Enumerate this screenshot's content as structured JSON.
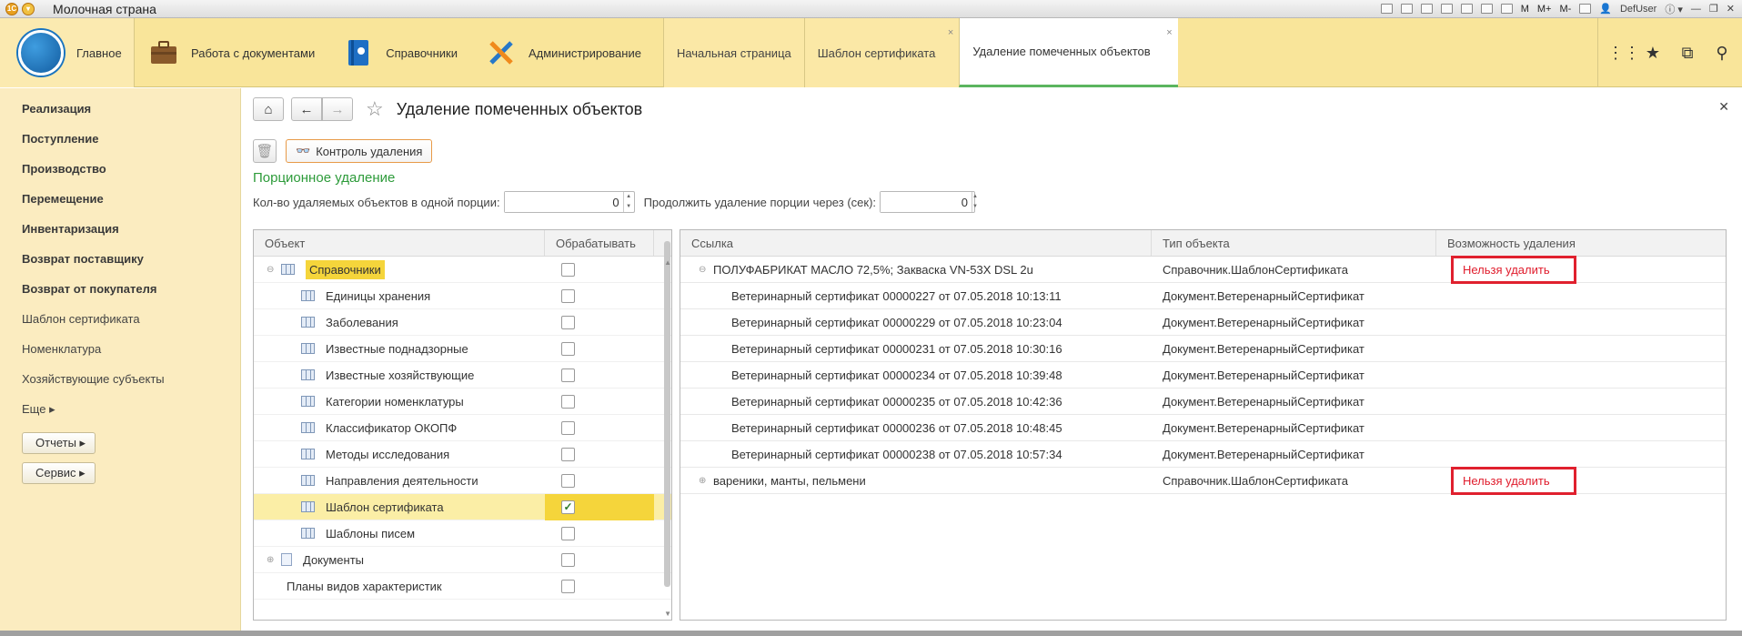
{
  "window": {
    "title": "Молочная страна",
    "user": "DefUser",
    "m_labels": [
      "M",
      "M+",
      "M-"
    ]
  },
  "nav": {
    "home": "Главное",
    "sections": [
      "Работа с документами",
      "Справочники",
      "Администрирование"
    ],
    "tabs": [
      "Начальная страница",
      "Шаблон сертификата",
      "Удаление помеченных объектов"
    ],
    "close_glyph": "×"
  },
  "sidebar": {
    "items": [
      {
        "label": "Реализация",
        "bold": true
      },
      {
        "label": "Поступление",
        "bold": true
      },
      {
        "label": "Производство",
        "bold": true
      },
      {
        "label": "Перемещение",
        "bold": true
      },
      {
        "label": "Инвентаризация",
        "bold": true
      },
      {
        "label": "Возврат поставщику",
        "bold": true
      },
      {
        "label": "Возврат от покупателя",
        "bold": true
      },
      {
        "label": "Шаблон сертификата",
        "bold": false
      },
      {
        "label": "Номенклатура",
        "bold": false
      },
      {
        "label": "Хозяйствующие субъекты",
        "bold": false
      },
      {
        "label": "Еще ▸",
        "bold": false
      }
    ],
    "buttons": [
      "Отчеты ▸",
      "Сервис ▸"
    ]
  },
  "page": {
    "title": "Удаление помеченных объектов",
    "control_button": "Контроль удаления",
    "section_title": "Порционное удаление",
    "portion_label": "Кол-во удаляемых объектов в одной порции:",
    "portion_value": "0",
    "continue_label": "Продолжить удаление порции через (сек):",
    "continue_value": "0"
  },
  "left_table": {
    "headers": [
      "Объект",
      "Обрабатывать"
    ],
    "rows": [
      {
        "label": "Справочники",
        "level": 0,
        "expander": "⊖",
        "icon": "grid",
        "checked": false,
        "highlight": true,
        "selected": false
      },
      {
        "label": "Единицы хранения",
        "level": 1,
        "expander": "",
        "icon": "grid",
        "checked": false,
        "highlight": false,
        "selected": false
      },
      {
        "label": "Заболевания",
        "level": 1,
        "expander": "",
        "icon": "grid",
        "checked": false,
        "highlight": false,
        "selected": false
      },
      {
        "label": "Известные поднадзорные",
        "level": 1,
        "expander": "",
        "icon": "grid",
        "checked": false,
        "highlight": false,
        "selected": false
      },
      {
        "label": "Известные хозяйствующие",
        "level": 1,
        "expander": "",
        "icon": "grid",
        "checked": false,
        "highlight": false,
        "selected": false
      },
      {
        "label": "Категории номенклатуры",
        "level": 1,
        "expander": "",
        "icon": "grid",
        "checked": false,
        "highlight": false,
        "selected": false
      },
      {
        "label": "Классификатор ОКОПФ",
        "level": 1,
        "expander": "",
        "icon": "grid",
        "checked": false,
        "highlight": false,
        "selected": false
      },
      {
        "label": "Методы исследования",
        "level": 1,
        "expander": "",
        "icon": "grid",
        "checked": false,
        "highlight": false,
        "selected": false
      },
      {
        "label": "Направления деятельности",
        "level": 1,
        "expander": "",
        "icon": "grid",
        "checked": false,
        "highlight": false,
        "selected": false
      },
      {
        "label": "Шаблон сертификата",
        "level": 1,
        "expander": "",
        "icon": "grid",
        "checked": true,
        "highlight": false,
        "selected": true
      },
      {
        "label": "Шаблоны писем",
        "level": 1,
        "expander": "",
        "icon": "grid",
        "checked": false,
        "highlight": false,
        "selected": false
      },
      {
        "label": "Документы",
        "level": 0,
        "expander": "⊕",
        "icon": "doc",
        "checked": false,
        "highlight": false,
        "selected": false
      },
      {
        "label": "Планы видов характеристик",
        "level": 0,
        "expander": "",
        "icon": "",
        "checked": false,
        "highlight": false,
        "selected": false
      }
    ]
  },
  "right_table": {
    "headers": [
      "Ссылка",
      "Тип объекта",
      "Возможность удаления"
    ],
    "rows": [
      {
        "link": "ПОЛУФАБРИКАТ МАСЛО 72,5%; Закваска VN-53X DSL 2u",
        "type": "Справочник.ШаблонСертификата",
        "status": "Нельзя удалить",
        "expander": "⊖",
        "child": false
      },
      {
        "link": "Ветеринарный сертификат 00000227 от 07.05.2018 10:13:11",
        "type": "Документ.ВетеренарныйСертификат",
        "status": "",
        "expander": "",
        "child": true
      },
      {
        "link": "Ветеринарный сертификат 00000229 от 07.05.2018 10:23:04",
        "type": "Документ.ВетеренарныйСертификат",
        "status": "",
        "expander": "",
        "child": true
      },
      {
        "link": "Ветеринарный сертификат 00000231 от 07.05.2018 10:30:16",
        "type": "Документ.ВетеренарныйСертификат",
        "status": "",
        "expander": "",
        "child": true
      },
      {
        "link": "Ветеринарный сертификат 00000234 от 07.05.2018 10:39:48",
        "type": "Документ.ВетеренарныйСертификат",
        "status": "",
        "expander": "",
        "child": true
      },
      {
        "link": "Ветеринарный сертификат 00000235 от 07.05.2018 10:42:36",
        "type": "Документ.ВетеренарныйСертификат",
        "status": "",
        "expander": "",
        "child": true
      },
      {
        "link": "Ветеринарный сертификат 00000236 от 07.05.2018 10:48:45",
        "type": "Документ.ВетеренарныйСертификат",
        "status": "",
        "expander": "",
        "child": true
      },
      {
        "link": "Ветеринарный сертификат 00000238 от 07.05.2018 10:57:34",
        "type": "Документ.ВетеренарныйСертификат",
        "status": "",
        "expander": "",
        "child": true
      },
      {
        "link": "вареники, манты, пельмени",
        "type": "Справочник.ШаблонСертификата",
        "status": "Нельзя удалить",
        "expander": "⊕",
        "child": false
      }
    ]
  },
  "colors": {
    "nav_bg": "#f9e59a",
    "sidebar_bg": "#fbecc0",
    "section_title": "#2d9b3a",
    "error_red": "#e01c2c",
    "selection": "#f5d53b"
  }
}
